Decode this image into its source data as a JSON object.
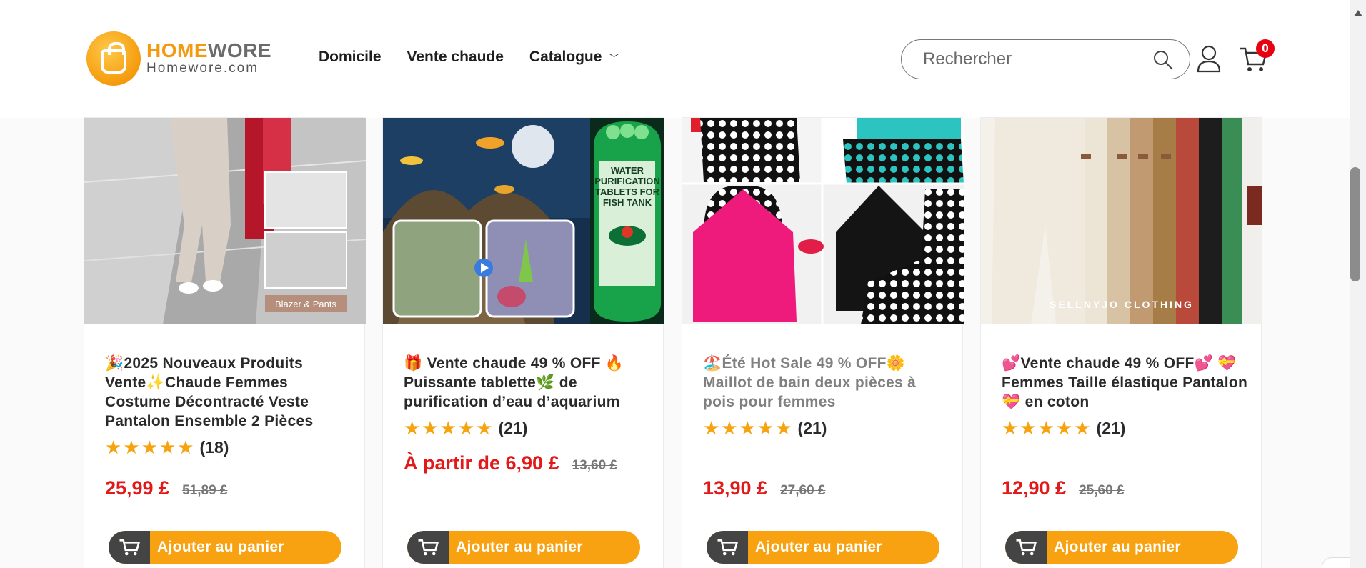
{
  "brand": {
    "name_part1": "HOME",
    "name_part2": "WORE",
    "url": "Homewore.com",
    "accent": "#f39a12"
  },
  "nav": {
    "items": [
      {
        "label": "Domicile"
      },
      {
        "label": "Vente chaude"
      },
      {
        "label": "Catalogue"
      }
    ]
  },
  "search": {
    "placeholder": "Rechercher"
  },
  "cart": {
    "count": "0"
  },
  "products": [
    {
      "title": "🎉2025 Nouveaux Produits Vente✨Chaude Femmes Costume Décontracté Veste Pantalon Ensemble 2 Pièces",
      "stars": "★★★★★",
      "reviews": "(18)",
      "price": "25,99 £",
      "old_price": "51,89 £",
      "button": "Ajouter au panier",
      "image_caption": "Blazer & Pants"
    },
    {
      "title": "🎁 Vente chaude 49 % OFF 🔥Puissante tablette🌿 de purification d’eau d’aquarium",
      "stars": "★★★★★",
      "reviews": "(21)",
      "price": "À partir de 6,90 £",
      "old_price": "13,60 £",
      "button": "Ajouter au panier",
      "image_caption": "WATER PURIFICATION TABLETS FOR FISH TANK"
    },
    {
      "title": "🏖️Été Hot Sale 49 % OFF🌼 Maillot de bain deux pièces à pois pour femmes",
      "stars": "★★★★★",
      "reviews": "(21)",
      "price": "13,90 £",
      "old_price": "27,60 £",
      "button": "Ajouter au panier"
    },
    {
      "title": "💕Vente chaude 49 % OFF💕 💝Femmes Taille élastique Pantalon💝 en coton",
      "stars": "★★★★★",
      "reviews": "(21)",
      "price": "12,90 £",
      "old_price": "25,60 £",
      "button": "Ajouter au panier",
      "image_caption": "SELLNYJO CLOTHING"
    }
  ]
}
